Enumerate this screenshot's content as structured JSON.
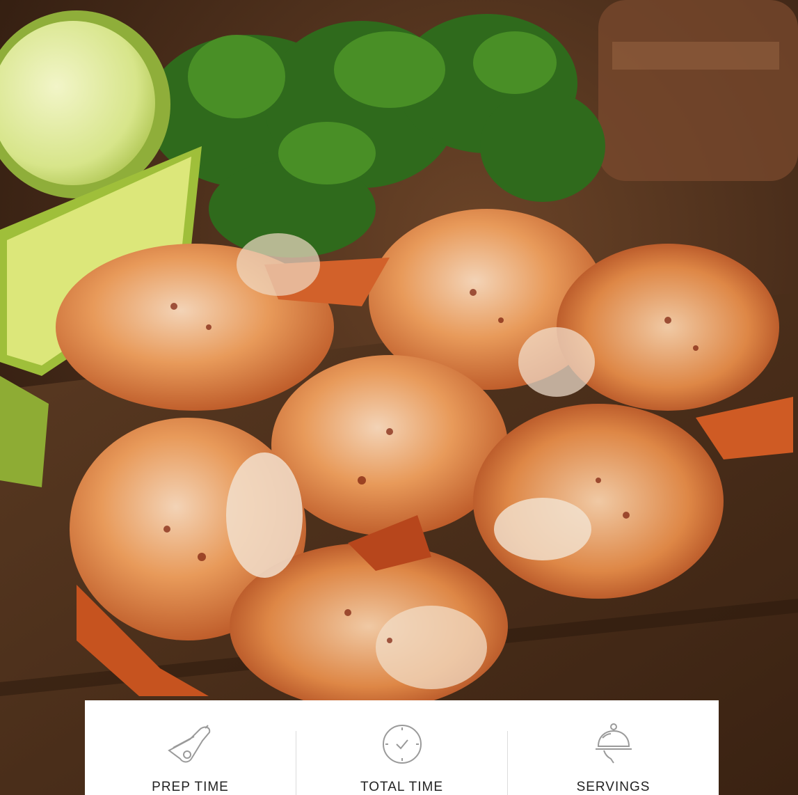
{
  "hero": {
    "image_subject": "seasoned-grilled-shrimp-with-lime-and-parsley"
  },
  "info_card": {
    "items": [
      {
        "icon": "prep-board-icon",
        "label": "PREP TIME"
      },
      {
        "icon": "clock-icon",
        "label": "TOTAL TIME"
      },
      {
        "icon": "serving-cloche-icon",
        "label": "SERVINGS"
      }
    ]
  },
  "colors": {
    "card_bg": "#ffffff",
    "label_text": "#222222",
    "icon_stroke": "#9a9a9a"
  }
}
